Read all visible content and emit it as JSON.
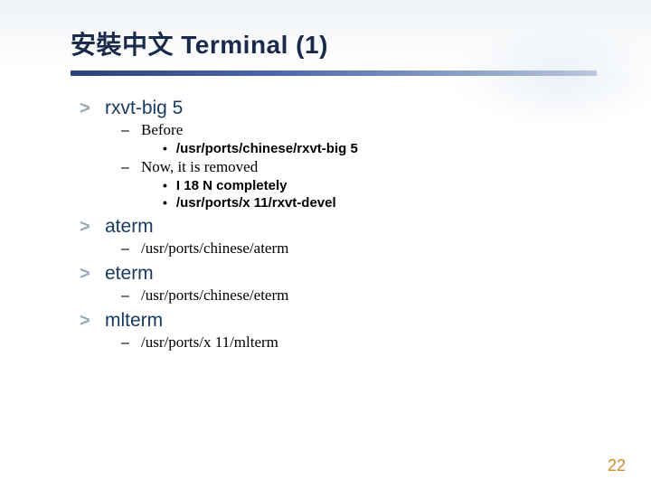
{
  "title": "安裝中文 Terminal (1)",
  "sections": [
    {
      "head": "rxvt-big 5",
      "subs": [
        {
          "label": "Before",
          "bullets": [
            "/usr/ports/chinese/rxvt-big 5"
          ]
        },
        {
          "label": "Now, it is removed",
          "bullets": [
            "I 18 N completely",
            "/usr/ports/x 11/rxvt-devel"
          ]
        }
      ]
    },
    {
      "head": "aterm",
      "subs": [
        {
          "label": "/usr/ports/chinese/aterm",
          "bullets": []
        }
      ]
    },
    {
      "head": "eterm",
      "subs": [
        {
          "label": "/usr/ports/chinese/eterm",
          "bullets": []
        }
      ]
    },
    {
      "head": "mlterm",
      "subs": [
        {
          "label": "/usr/ports/x 11/mlterm",
          "bullets": []
        }
      ]
    }
  ],
  "markers": {
    "l1": ">",
    "l2": "–",
    "l3": "•"
  },
  "page_number": "22"
}
